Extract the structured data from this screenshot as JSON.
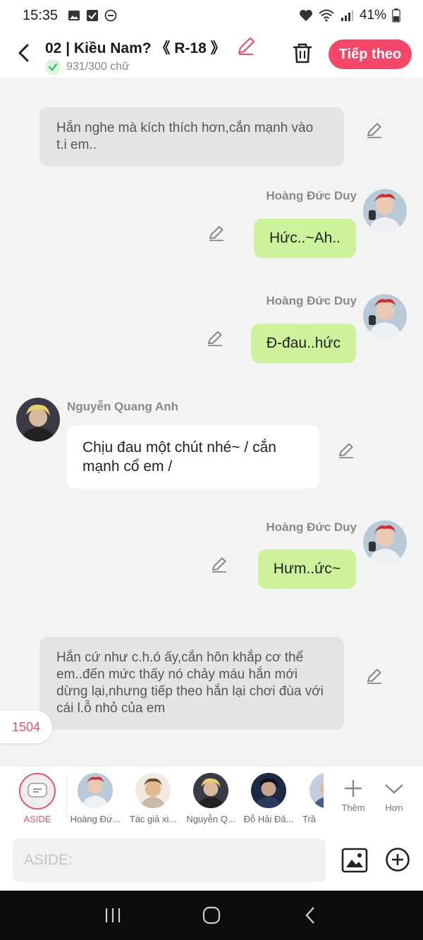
{
  "status": {
    "time": "15:35",
    "battery": "41%",
    "left_icons": [
      "image-icon",
      "check-square-icon",
      "dnd-icon"
    ],
    "right_icons": [
      "heart-icon",
      "wifi-icon",
      "signal-icon",
      "battery-icon"
    ]
  },
  "header": {
    "title": "02 | Kiều Nam? 《 R-18 》",
    "word_count": "931/300 chữ",
    "next_label": "Tiếp theo"
  },
  "messages": [
    {
      "type": "narration",
      "text": "Hắn nghe mà kích thích hơn,cắn mạnh vào t.i em.."
    },
    {
      "type": "right",
      "speaker": "Hoàng Đức Duy",
      "text": "Hức..~Ah.."
    },
    {
      "type": "right",
      "speaker": "Hoàng Đức Duy",
      "text": "Đ-đau..hức"
    },
    {
      "type": "left",
      "speaker": "Nguyễn Quang Anh",
      "text": "Chịu đau một chút nhé~ / cắn mạnh cổ em /"
    },
    {
      "type": "right",
      "speaker": "Hoàng Đức Duy",
      "text": "Hưm..ức~"
    },
    {
      "type": "narration",
      "text": "Hắn cứ như c.h.ó ấy,cắn hôn khắp cơ thể em..đến mức thấy nó chảy máu hắn mới dừng lại,nhưng tiếp theo hắn lại chơi đùa với cái l.ỗ nhỏ của em"
    }
  ],
  "message_count": "1504",
  "characters": {
    "aside_label": "ASIDE",
    "items": [
      {
        "name": "Hoàng Đứ..."
      },
      {
        "name": "Tác giả xi..."
      },
      {
        "name": "Nguyễn Q..."
      },
      {
        "name": "Đỗ Hải Đă..."
      },
      {
        "name": "Trầ"
      }
    ],
    "add_label": "Thêm",
    "more_label": "Hơn"
  },
  "composer": {
    "placeholder": "ASIDE:"
  },
  "colors": {
    "accent": "#f5476a",
    "bubble_right": "#ccf39b",
    "narration_bg": "#e4e4e4"
  }
}
